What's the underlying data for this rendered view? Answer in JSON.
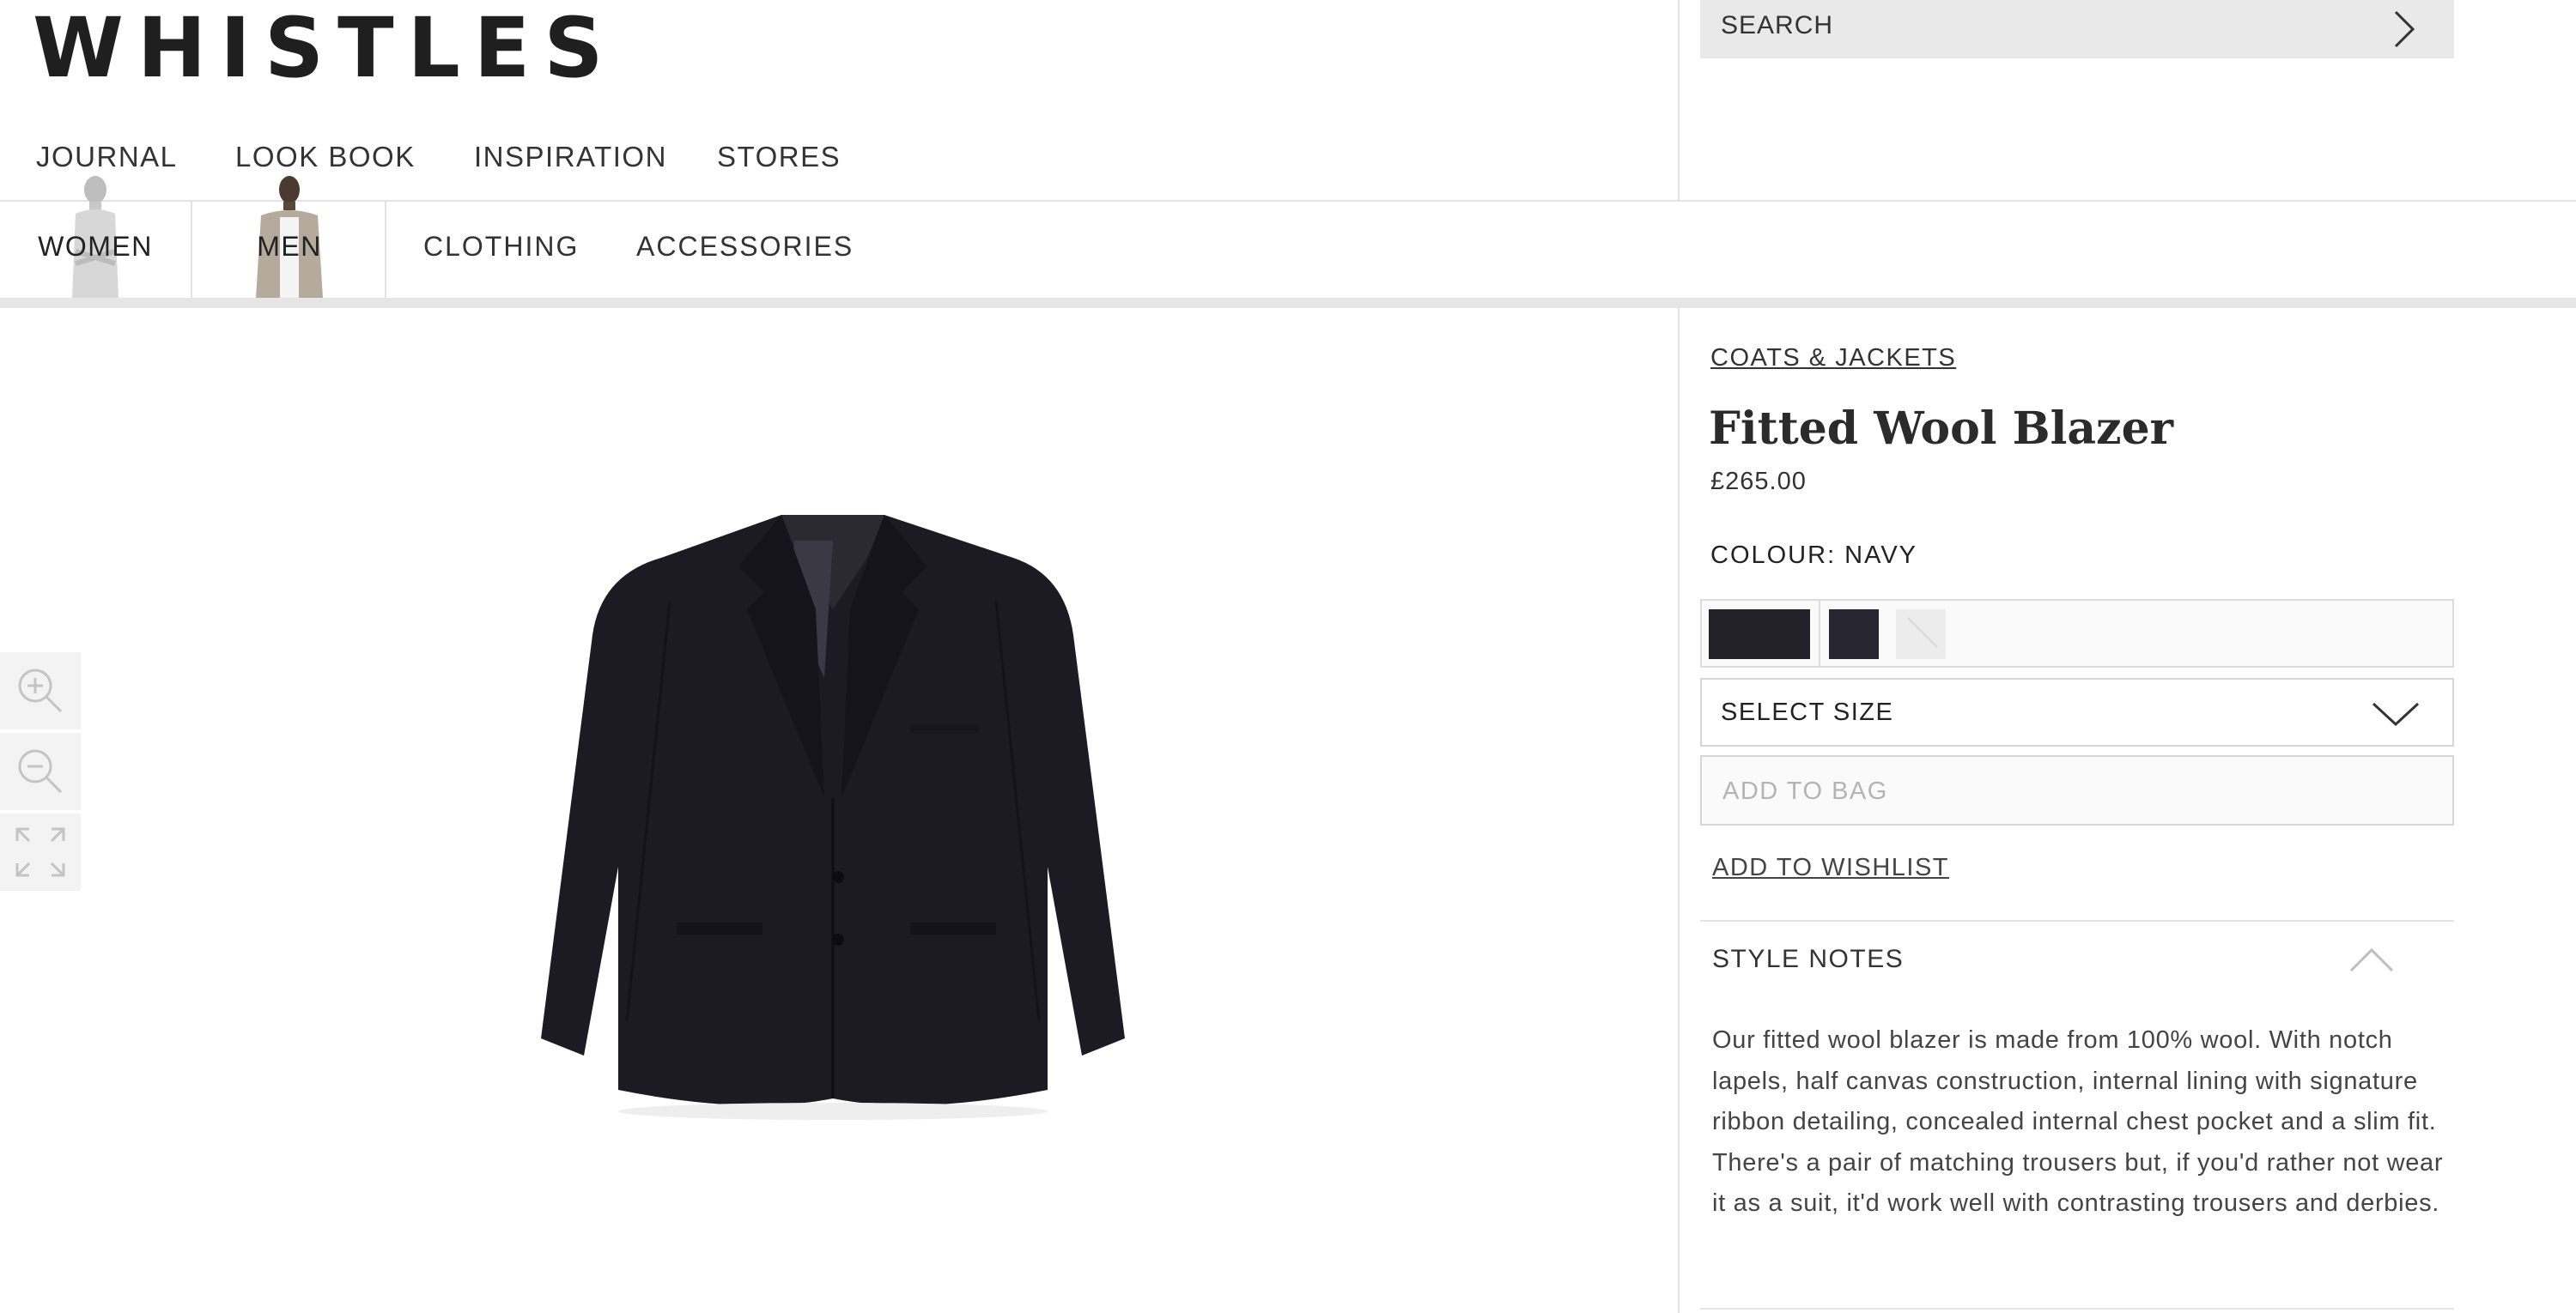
{
  "brand": {
    "logo_text": "WHISTLES"
  },
  "search": {
    "label": "SEARCH"
  },
  "top_nav": {
    "items": [
      "JOURNAL",
      "LOOK BOOK",
      "INSPIRATION",
      "STORES"
    ]
  },
  "category_nav": {
    "genders": [
      "WOMEN",
      "MEN"
    ],
    "categories": [
      "CLOTHING",
      "ACCESSORIES"
    ]
  },
  "product": {
    "breadcrumb": "COATS & JACKETS",
    "title": "Fitted Wool Blazer",
    "price": "£265.00",
    "colour_label": "COLOUR: NAVY",
    "swatch_colors": [
      "#23222b",
      "#262530",
      "#ececec"
    ],
    "size_select_label": "SELECT SIZE",
    "add_to_bag_label": "ADD TO BAG",
    "wishlist_label": "ADD TO WISHLIST",
    "style_notes_title": "STYLE NOTES",
    "style_notes_body": "Our fitted wool blazer is made from 100% wool. With notch lapels, half canvas construction, internal lining with signature ribbon detailing, concealed internal chest pocket and a slim fit. There's a pair of matching trousers but, if you'd rather not wear it as a suit, it'd work well with contrasting trousers and derbies."
  },
  "image_controls": {
    "icons": [
      "zoom-in-icon",
      "zoom-out-icon",
      "fullscreen-icon"
    ]
  }
}
